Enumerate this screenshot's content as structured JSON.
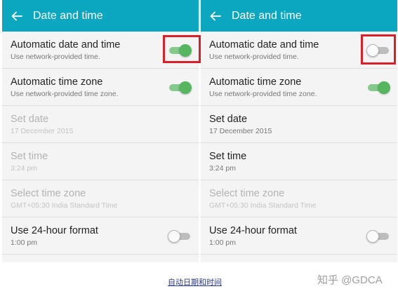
{
  "screen_left": {
    "appbar": {
      "title": "Date and time"
    },
    "rows": [
      {
        "title": "Automatic date and time",
        "subtitle": "Use network-provided time."
      },
      {
        "title": "Automatic time zone",
        "subtitle": "Use network-provided time zone."
      },
      {
        "title": "Set date",
        "subtitle": "17 December 2015"
      },
      {
        "title": "Set time",
        "subtitle": "3:24 pm"
      },
      {
        "title": "Select time zone",
        "subtitle": "GMT+05:30 India Standard Time"
      },
      {
        "title": "Use 24-hour format",
        "subtitle": "1:00 pm"
      }
    ],
    "toggles": {
      "auto_date_time": "on",
      "auto_time_zone": "on",
      "use_24_hour": "off"
    }
  },
  "screen_right": {
    "appbar": {
      "title": "Date and time"
    },
    "rows": [
      {
        "title": "Automatic date and time",
        "subtitle": "Use network-provided time."
      },
      {
        "title": "Automatic time zone",
        "subtitle": "Use network-provided time zone."
      },
      {
        "title": "Set date",
        "subtitle": "17 December 2015"
      },
      {
        "title": "Set time",
        "subtitle": "3:24 pm"
      },
      {
        "title": "Select time zone",
        "subtitle": "GMT+05:30 India Standard Time"
      },
      {
        "title": "Use 24-hour format",
        "subtitle": "1:00 pm"
      }
    ],
    "toggles": {
      "auto_date_time": "off",
      "auto_time_zone": "on",
      "use_24_hour": "off"
    }
  },
  "caption": "自动日期和时间",
  "watermark": "知乎 @GDCA",
  "colors": {
    "appbar": "#0ba6c0",
    "switch_on": "#56b65f",
    "highlight": "#d81f2a",
    "caption": "#2c3a8c"
  },
  "icons": {
    "back": "arrow-back-icon"
  }
}
